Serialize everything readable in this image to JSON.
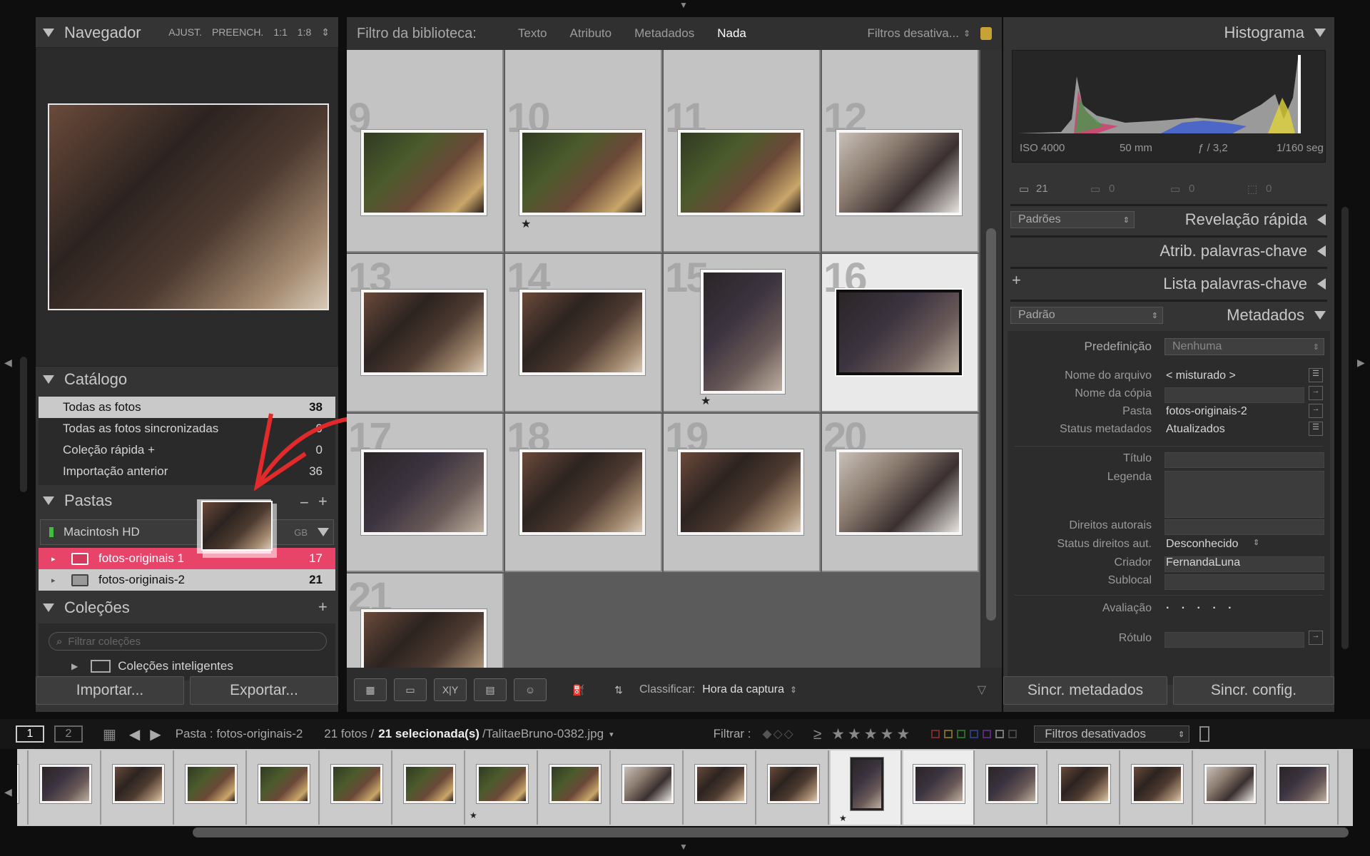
{
  "left": {
    "navigator": {
      "title": "Navegador",
      "modes": [
        "AJUST.",
        "PREENCH.",
        "1:1",
        "1:8"
      ]
    },
    "catalog": {
      "title": "Catálogo",
      "items": [
        {
          "label": "Todas as fotos",
          "count": "38"
        },
        {
          "label": "Todas as fotos sincronizadas",
          "count": "0"
        },
        {
          "label": "Coleção rápida +",
          "count": "0"
        },
        {
          "label": "Importação anterior",
          "count": "36"
        }
      ]
    },
    "folders": {
      "title": "Pastas",
      "drive": "Macintosh HD",
      "drive_size": "GB",
      "items": [
        {
          "label": "fotos-originais 1",
          "count": "17"
        },
        {
          "label": "fotos-originais-2",
          "count": "21"
        }
      ]
    },
    "collections": {
      "title": "Coleções",
      "search_placeholder": "Filtrar coleções",
      "smart": "Coleções inteligentes"
    },
    "import_label": "Importar...",
    "export_label": "Exportar..."
  },
  "filter_bar": {
    "title": "Filtro da biblioteca:",
    "tabs": [
      "Texto",
      "Atributo",
      "Metadados",
      "Nada"
    ],
    "preset": "Filtros desativa..."
  },
  "grid": {
    "cells": [
      {
        "num": "9",
        "star": false
      },
      {
        "num": "10",
        "star": true
      },
      {
        "num": "11",
        "star": false
      },
      {
        "num": "12",
        "star": false
      },
      {
        "num": "13",
        "star": false
      },
      {
        "num": "14",
        "star": false
      },
      {
        "num": "15",
        "star": true
      },
      {
        "num": "16",
        "star": false
      },
      {
        "num": "17",
        "star": false
      },
      {
        "num": "18",
        "star": false
      },
      {
        "num": "19",
        "star": false
      },
      {
        "num": "20",
        "star": false
      },
      {
        "num": "21",
        "star": false
      }
    ],
    "star_char": "★"
  },
  "toolbar": {
    "sort_label": "Classificar:",
    "sort_value": "Hora da captura"
  },
  "right": {
    "histogram": {
      "title": "Histograma",
      "iso": "ISO 4000",
      "focal": "50 mm",
      "aperture": "ƒ / 3,2",
      "shutter": "1/160 seg",
      "count": "21",
      "c2": "0",
      "c3": "0",
      "c4": "0"
    },
    "quick_develop": {
      "preset": "Padrões",
      "title": "Revelação rápida"
    },
    "keywording": {
      "title": "Atrib. palavras-chave"
    },
    "keyword_list": {
      "title": "Lista palavras-chave",
      "plus": "+"
    },
    "metadata": {
      "preset_dropdown": "Padrão",
      "title": "Metadados",
      "predef_label": "Predefinição",
      "predef_value": "Nenhuma",
      "rows": [
        {
          "label": "Nome do arquivo",
          "value": "< misturado >"
        },
        {
          "label": "Nome da cópia",
          "value": ""
        },
        {
          "label": "Pasta",
          "value": "fotos-originais-2"
        },
        {
          "label": "Status metadados",
          "value": "Atualizados"
        },
        {
          "label": "Título",
          "value": ""
        },
        {
          "label": "Legenda",
          "value": ""
        },
        {
          "label": "Direitos autorais",
          "value": ""
        },
        {
          "label": "Status direitos aut.",
          "value": "Desconhecido"
        },
        {
          "label": "Criador",
          "value": "FernandaLuna"
        },
        {
          "label": "Sublocal",
          "value": ""
        },
        {
          "label": "Avaliação",
          "value": "· · · · ·"
        },
        {
          "label": "Rótulo",
          "value": ""
        }
      ]
    },
    "sync_metadata": "Sincr. metadados",
    "sync_settings": "Sincr. config."
  },
  "bottom": {
    "screen1": "1",
    "screen2": "2",
    "path": "Pasta : fotos-originais-2",
    "selection_prefix": "21 fotos /",
    "selection_bold": "21 selecionada(s)",
    "selection_file": "/TalitaeBruno-0382.jpg",
    "filter_label": "Filtrar :",
    "stars": "≥ ★★★★★",
    "filter_preset": "Filtros desativados"
  },
  "colors": {
    "highlight": "#e8446a",
    "selected_cell": "#e9e9e9",
    "cell": "#c3c3c3",
    "arrow": "#e22a2a"
  }
}
